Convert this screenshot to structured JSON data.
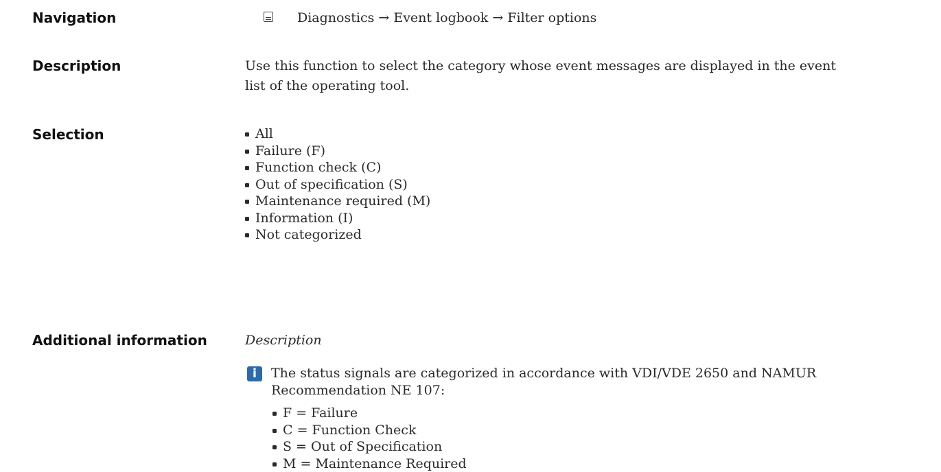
{
  "navigation": {
    "label": "Navigation",
    "path": "Diagnostics → Event logbook → Filter options"
  },
  "description": {
    "label": "Description",
    "line1": "Use this function to select the category whose event messages are displayed in the event",
    "line2": "list of the operating tool."
  },
  "selection": {
    "label": "Selection",
    "items": [
      "All",
      "Failure (F)",
      "Function check (C)",
      "Out of specification (S)",
      "Maintenance required (M)",
      "Information (I)",
      "Not categorized"
    ]
  },
  "additional": {
    "label": "Additional information",
    "subheading": "Description",
    "note_line1": "The status signals are categorized in accordance with VDI/VDE 2650 and NAMUR",
    "note_line2": "Recommendation NE 107:",
    "codes": [
      "F = Failure",
      "C = Function Check",
      "S = Out of Specification",
      "M = Maintenance Required"
    ]
  },
  "icons": {
    "navigation": "device-display-icon",
    "note": "info-icon",
    "note_color": "#2d6aab"
  }
}
